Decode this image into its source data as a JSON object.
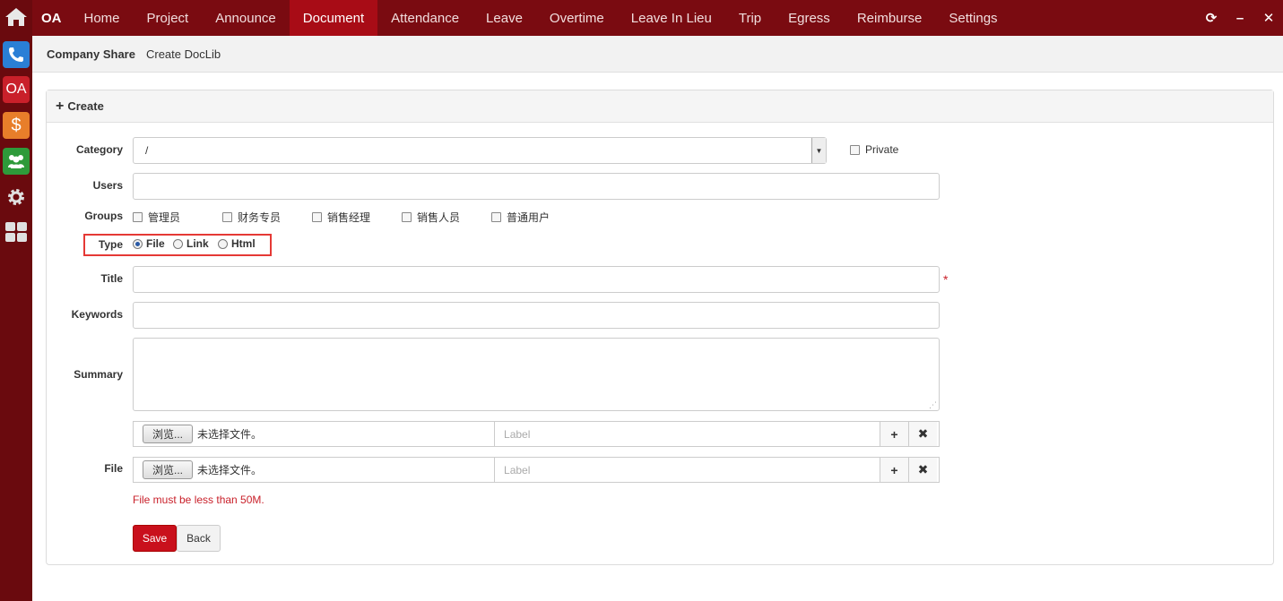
{
  "dock": {
    "oa_label": "OA",
    "money_label": "$"
  },
  "nav": {
    "brand": "OA",
    "items": [
      "Home",
      "Project",
      "Announce",
      "Document",
      "Attendance",
      "Leave",
      "Overtime",
      "Leave In Lieu",
      "Trip",
      "Egress",
      "Reimburse",
      "Settings"
    ],
    "active": "Document"
  },
  "breadcrumb": {
    "root": "Company Share",
    "current": "Create DocLib"
  },
  "panel": {
    "title": "Create"
  },
  "form": {
    "category_label": "Category",
    "category_value": "/",
    "private_label": "Private",
    "users_label": "Users",
    "groups_label": "Groups",
    "groups": [
      "管理员",
      "财务专员",
      "销售经理",
      "销售人员",
      "普通用户"
    ],
    "type_label": "Type",
    "types": [
      "File",
      "Link",
      "Html"
    ],
    "type_selected": "File",
    "title_label": "Title",
    "required_mark": "*",
    "keywords_label": "Keywords",
    "summary_label": "Summary",
    "file_label": "File",
    "browse_label": "浏览...",
    "no_file_text": "未选择文件。",
    "label_placeholder": "Label",
    "file_hint": "File must be less than 50M.",
    "save_label": "Save",
    "back_label": "Back"
  },
  "colors": {
    "nav_bg": "#7a0b11",
    "nav_active": "#a80c16",
    "primary": "#c9101c"
  }
}
